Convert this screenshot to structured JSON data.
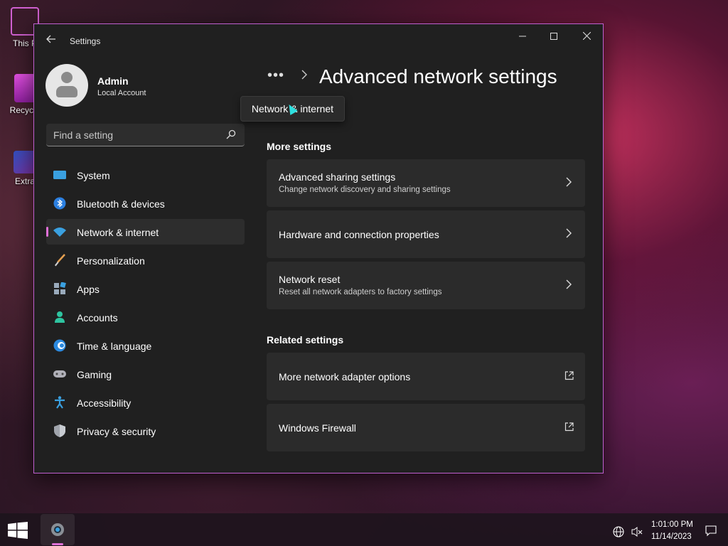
{
  "desktop": {
    "icons": [
      {
        "label": "This P"
      },
      {
        "label": "Recycle"
      },
      {
        "label": "Extra"
      }
    ]
  },
  "window": {
    "title": "Settings",
    "controls": {
      "minimize": "—",
      "maximize": "☐",
      "close": "✕"
    }
  },
  "profile": {
    "name": "Admin",
    "account_type": "Local Account"
  },
  "search": {
    "placeholder": "Find a setting"
  },
  "sidebar": {
    "items": [
      {
        "label": "System",
        "icon": "system-icon"
      },
      {
        "label": "Bluetooth & devices",
        "icon": "bluetooth-icon"
      },
      {
        "label": "Network & internet",
        "icon": "wifi-icon",
        "active": true
      },
      {
        "label": "Personalization",
        "icon": "brush-icon"
      },
      {
        "label": "Apps",
        "icon": "apps-icon"
      },
      {
        "label": "Accounts",
        "icon": "accounts-icon"
      },
      {
        "label": "Time & language",
        "icon": "globe-icon"
      },
      {
        "label": "Gaming",
        "icon": "gamepad-icon"
      },
      {
        "label": "Accessibility",
        "icon": "accessibility-icon"
      },
      {
        "label": "Privacy & security",
        "icon": "shield-icon"
      }
    ]
  },
  "main": {
    "breadcrumb_more": "•••",
    "title": "Advanced network settings",
    "tooltip": "Network & internet",
    "more_settings": {
      "heading": "More settings",
      "cards": [
        {
          "title": "Advanced sharing settings",
          "subtitle": "Change network discovery and sharing settings"
        },
        {
          "title": "Hardware and connection properties",
          "subtitle": ""
        },
        {
          "title": "Network reset",
          "subtitle": "Reset all network adapters to factory settings"
        }
      ]
    },
    "related_settings": {
      "heading": "Related settings",
      "cards": [
        {
          "title": "More network adapter options"
        },
        {
          "title": "Windows Firewall"
        }
      ]
    }
  },
  "taskbar": {
    "time": "1:01:00 PM",
    "date": "11/14/2023"
  },
  "colors": {
    "accent": "#e070d8",
    "window_bg": "#202020",
    "card_bg": "#2b2b2b"
  }
}
